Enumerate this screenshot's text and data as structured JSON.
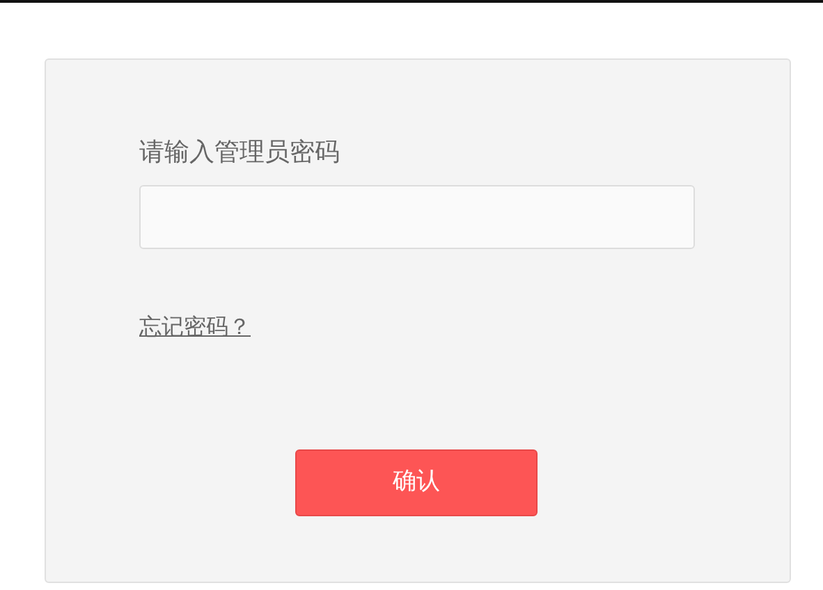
{
  "login": {
    "label": "请输入管理员密码",
    "forgot_link": "忘记密码？",
    "confirm_button": "确认"
  }
}
